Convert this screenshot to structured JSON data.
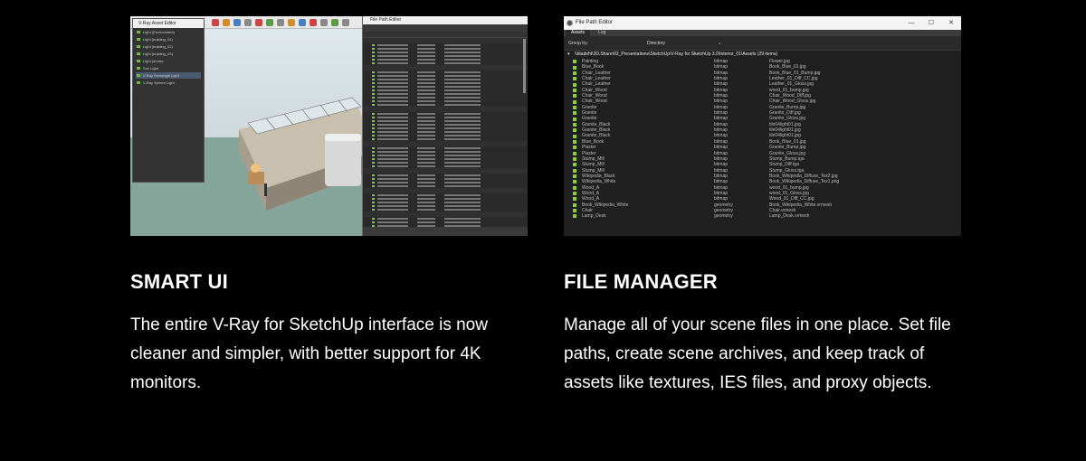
{
  "features": [
    {
      "heading": "SMART UI",
      "body": "The entire V-Ray for SketchUp interface is now cleaner and simpler, with better support for 4K monitors."
    },
    {
      "heading": "FILE MANAGER",
      "body": "Manage all of your scene files in one place. Set file paths, create scene archives, and keep track of assets like textures, IES files, and proxy objects."
    }
  ],
  "colors": {
    "background": "#000000",
    "text": "#ffffff",
    "checkbox_green": "#8bd236"
  },
  "file_path_editor": {
    "window_title": "File Path Editor",
    "window_controls": [
      "—",
      "☐",
      "✕"
    ],
    "tabs": [
      "Assets",
      "Log"
    ],
    "group_by_label": "Group by:",
    "group_by_value": "Directory",
    "folder": "\\\\bladeht\\3D.Share\\02_Presentations\\SketchUp\\V-Ray for SketchUp 3.0\\Interior_01\\Assets (29 items)",
    "rows": [
      [
        "Painting",
        "bitmap",
        "Flower.jpg"
      ],
      [
        "Blue_Book",
        "bitmap",
        "Book_Blue_01.jpg"
      ],
      [
        "Chair_Leather",
        "bitmap",
        "Book_Blue_01_Bump.jpg"
      ],
      [
        "Chair_Leather",
        "bitmap",
        "Leather_01_Diff_CC.jpg"
      ],
      [
        "Chair_Leather",
        "bitmap",
        "Leather_01_Gloss.jpg"
      ],
      [
        "Chair_Wood",
        "bitmap",
        "wood_01_bump.jpg"
      ],
      [
        "Chair_Wood",
        "bitmap",
        "Chair_Wood_Diff.jpg"
      ],
      [
        "Chair_Wood",
        "bitmap",
        "Chair_Wood_Gloss.jpg"
      ],
      [
        "Granite",
        "bitmap",
        "Granite_Bump.jpg"
      ],
      [
        "Granite",
        "bitmap",
        "Granite_Diff.jpg"
      ],
      [
        "Granite",
        "bitmap",
        "Granite_Gloss.jpg"
      ],
      [
        "Granite_Black",
        "bitmap",
        "tile04light01.jpg"
      ],
      [
        "Granite_Black",
        "bitmap",
        "tile04light01.jpg"
      ],
      [
        "Granite_Black",
        "bitmap",
        "tile04light01.jpg"
      ],
      [
        "Blue_Book",
        "bitmap",
        "Book_Blue_01.jpg"
      ],
      [
        "Plaster",
        "bitmap",
        "Granite_Bump.jpg"
      ],
      [
        "Plaster",
        "bitmap",
        "Granite_Gloss.jpg"
      ],
      [
        "Stump_Mill",
        "bitmap",
        "Stump_Bump.tga"
      ],
      [
        "Stump_Mill",
        "bitmap",
        "Stump_Diff.tga"
      ],
      [
        "Stump_Mill",
        "bitmap",
        "Stump_Gloss.tga"
      ],
      [
        "Wikipedia_Black",
        "bitmap",
        "Book_Wikipedia_Diffuse_Tex2.jpg"
      ],
      [
        "Wikipedia_White",
        "bitmap",
        "Book_Wikipedia_Diffuse_Tex1.png"
      ],
      [
        "Wood_A",
        "bitmap",
        "wood_01_bump.jpg"
      ],
      [
        "Wood_A",
        "bitmap",
        "wood_01_Gloss.jpg"
      ],
      [
        "Wood_A",
        "bitmap",
        "Wood_01_Diff_CC.jpg"
      ],
      [
        "Book_Wikipedia_White",
        "geometry",
        "Book_Wikipedia_White.vrmesh"
      ],
      [
        "Chair",
        "geometry",
        "Chair.vrmesh"
      ],
      [
        "Lamp_Desk",
        "geometry",
        "Lamp_Desk.vrmesh"
      ]
    ]
  },
  "smart_ui_screenshot": {
    "outliner_title": "V-Ray Asset Editor",
    "outliner_items": [
      "Light (Environment)",
      "Light (building_01)",
      "Light (building_02)",
      "Light (building_03)",
      "Light (dome)",
      "Sun Light",
      "V-Ray Rectangle Light",
      "V-Ray Sphere Light"
    ],
    "file_path_editor_title": "File Path Editor"
  }
}
